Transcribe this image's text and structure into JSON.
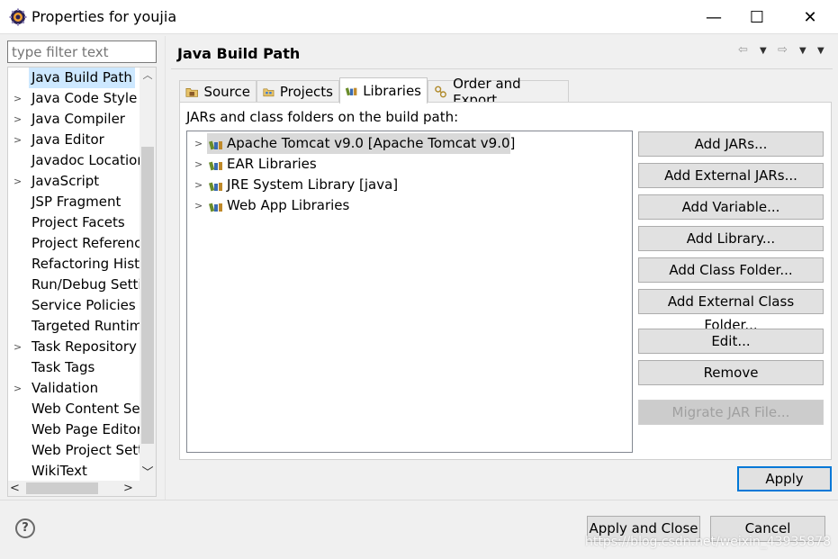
{
  "window": {
    "title": "Properties for youjia",
    "minimize": "—",
    "maximize": "☐",
    "close": "✕"
  },
  "filter": {
    "placeholder": "type filter text"
  },
  "nav": {
    "items": [
      {
        "label": "Java Build Path",
        "expandable": false,
        "selected": true
      },
      {
        "label": "Java Code Style",
        "expandable": true
      },
      {
        "label": "Java Compiler",
        "expandable": true
      },
      {
        "label": "Java Editor",
        "expandable": true
      },
      {
        "label": "Javadoc Location",
        "expandable": false
      },
      {
        "label": "JavaScript",
        "expandable": true
      },
      {
        "label": "JSP Fragment",
        "expandable": false
      },
      {
        "label": "Project Facets",
        "expandable": false
      },
      {
        "label": "Project References",
        "expandable": false
      },
      {
        "label": "Refactoring History",
        "expandable": false
      },
      {
        "label": "Run/Debug Settings",
        "expandable": false
      },
      {
        "label": "Service Policies",
        "expandable": false
      },
      {
        "label": "Targeted Runtimes",
        "expandable": false
      },
      {
        "label": "Task Repository",
        "expandable": true
      },
      {
        "label": "Task Tags",
        "expandable": false
      },
      {
        "label": "Validation",
        "expandable": true
      },
      {
        "label": "Web Content Settings",
        "expandable": false
      },
      {
        "label": "Web Page Editor",
        "expandable": false
      },
      {
        "label": "Web Project Settings",
        "expandable": false
      },
      {
        "label": "WikiText",
        "expandable": false
      }
    ]
  },
  "page": {
    "title": "Java Build Path",
    "tabs": [
      {
        "label": "Source",
        "icon": "source-folder-icon"
      },
      {
        "label": "Projects",
        "icon": "projects-icon"
      },
      {
        "label": "Libraries",
        "icon": "libraries-icon",
        "active": true
      },
      {
        "label": "Order and Export",
        "icon": "order-export-icon"
      }
    ],
    "panel_label": "JARs and class folders on the build path:",
    "libraries": [
      {
        "label": "Apache Tomcat v9.0 [Apache Tomcat v9.0]",
        "selected": true
      },
      {
        "label": "EAR Libraries"
      },
      {
        "label": "JRE System Library [java]"
      },
      {
        "label": "Web App Libraries"
      }
    ],
    "buttons": {
      "add_jars": "Add JARs...",
      "add_external_jars": "Add External JARs...",
      "add_variable": "Add Variable...",
      "add_library": "Add Library...",
      "add_class_folder": "Add Class Folder...",
      "add_external_class_folder": "Add External Class Folder...",
      "edit": "Edit...",
      "remove": "Remove",
      "migrate_jar": "Migrate JAR File..."
    },
    "apply": "Apply"
  },
  "footer": {
    "help": "?",
    "apply_and_close": "Apply and Close",
    "cancel": "Cancel",
    "watermark": "https://blog.csdn.net/weixin_43935878"
  },
  "colors": {
    "accent": "#0078d7",
    "selection": "#cde8ff",
    "tree_selection": "#d9d9d9"
  }
}
